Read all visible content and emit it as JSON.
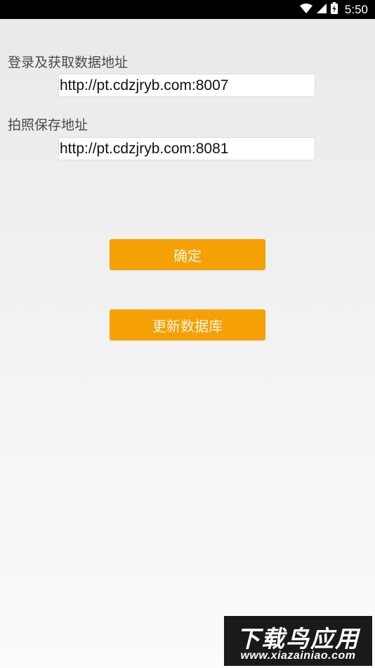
{
  "status_bar": {
    "time": "5:50",
    "icons": [
      "wifi-icon",
      "cell-signal-icon",
      "battery-icon"
    ]
  },
  "form": {
    "login_label": "登录及获取数据地址",
    "login_url": "http://pt.cdzjryb.com:8007",
    "photo_label": "拍照保存地址",
    "photo_url": "http://pt.cdzjryb.com:8081"
  },
  "buttons": {
    "confirm": "确定",
    "update_db": "更新数据库"
  },
  "watermark": {
    "title": "下载鸟应用",
    "url": "www.xiazainiao.com"
  },
  "colors": {
    "button_bg": "#f5a105",
    "status_bar_bg": "#000000"
  }
}
